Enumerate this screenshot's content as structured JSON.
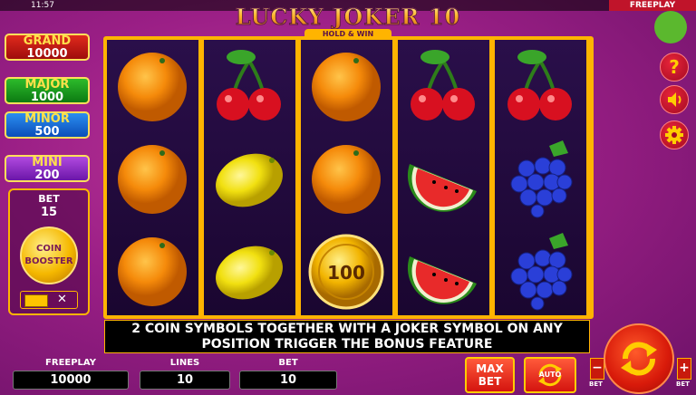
{
  "status_bar": {
    "clock": "11:57",
    "mode": "FREEPLAY"
  },
  "logo": {
    "title": "LUCKY JOKER 10",
    "subtitle": "HOLD & WIN"
  },
  "jackpots": [
    {
      "name": "GRAND",
      "value": "10000"
    },
    {
      "name": "MAJOR",
      "value": "1000"
    },
    {
      "name": "MINOR",
      "value": "500"
    },
    {
      "name": "MINI",
      "value": "200"
    }
  ],
  "bet_panel": {
    "label": "BET",
    "value": "15",
    "coin_booster_line1": "COIN",
    "coin_booster_line2": "BOOSTER",
    "toggle_off": "✕"
  },
  "reels": [
    [
      "orange",
      "orange",
      "orange"
    ],
    [
      "cherries",
      "lemon",
      "lemon"
    ],
    [
      "orange",
      "orange",
      "coin"
    ],
    [
      "cherries",
      "watermelon",
      "watermelon"
    ],
    [
      "cherries",
      "grapes",
      "grapes"
    ]
  ],
  "coin_value": "100",
  "message": {
    "line1": "2 COIN SYMBOLS TOGETHER WITH A JOKER SYMBOL ON ANY",
    "line2": "POSITION TRIGGER THE BONUS FEATURE"
  },
  "stats": {
    "freeplay_label": "FREEPLAY",
    "freeplay_value": "10000",
    "lines_label": "LINES",
    "lines_value": "10",
    "bet_label": "BET",
    "bet_value": "10"
  },
  "buttons": {
    "max_bet_line1": "MAX",
    "max_bet_line2": "BET",
    "auto": "AUTO",
    "minus": "−",
    "plus": "+",
    "bet_small": "BET",
    "help": "?"
  },
  "colors": {
    "accent": "#ffb400",
    "frame_bg": "#2a0f4a",
    "status_green": "#5bb82e"
  }
}
